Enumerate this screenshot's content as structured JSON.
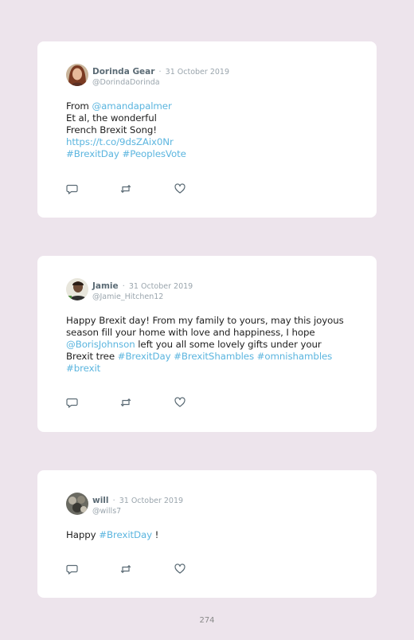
{
  "tweets": [
    {
      "name": "Dorinda Gear",
      "separator": "·",
      "date": "31 October 2019",
      "handle": "@DorindaDorinda",
      "body": [
        {
          "t": "From "
        },
        {
          "t": "@amandapalmer",
          "hl": true
        },
        {
          "br": true
        },
        {
          "t": "Et al, the wonderful"
        },
        {
          "br": true
        },
        {
          "t": "French Brexit Song!"
        },
        {
          "br": true
        },
        {
          "t": "https://t.co/9dsZAix0Nr",
          "hl": true
        },
        {
          "br": true
        },
        {
          "t": "#BrexitDay",
          "hl": true
        },
        {
          "t": " "
        },
        {
          "t": "#PeoplesVote",
          "hl": true
        }
      ]
    },
    {
      "name": "Jamie",
      "separator": "·",
      "date": "31 October 2019",
      "handle": "@Jamie_Hitchen12",
      "body": [
        {
          "t": "Happy Brexit day! From my family to yours, may this joyous"
        },
        {
          "br": true
        },
        {
          "t": "season fill your home with love and happiness, I hope"
        },
        {
          "br": true
        },
        {
          "t": "@BorisJohnson",
          "hl": true
        },
        {
          "t": " left you all some lovely gifts under your"
        },
        {
          "br": true
        },
        {
          "t": "Brexit tree "
        },
        {
          "t": "#BrexitDay",
          "hl": true
        },
        {
          "t": " "
        },
        {
          "t": "#BrexitShambles",
          "hl": true
        },
        {
          "t": " "
        },
        {
          "t": "#omnishambles",
          "hl": true
        },
        {
          "br": true
        },
        {
          "t": "#brexit",
          "hl": true
        }
      ]
    },
    {
      "name": "will",
      "separator": "·",
      "date": "31 October 2019",
      "handle": "@wills7",
      "body": [
        {
          "t": "Happy "
        },
        {
          "t": "#BrexitDay",
          "hl": true
        },
        {
          "t": " !"
        }
      ]
    }
  ],
  "page_number": "274",
  "colors": {
    "link": "#5bb5df",
    "background": "#ede4ec",
    "name": "#5b6b75",
    "muted": "#9aa5ad"
  }
}
